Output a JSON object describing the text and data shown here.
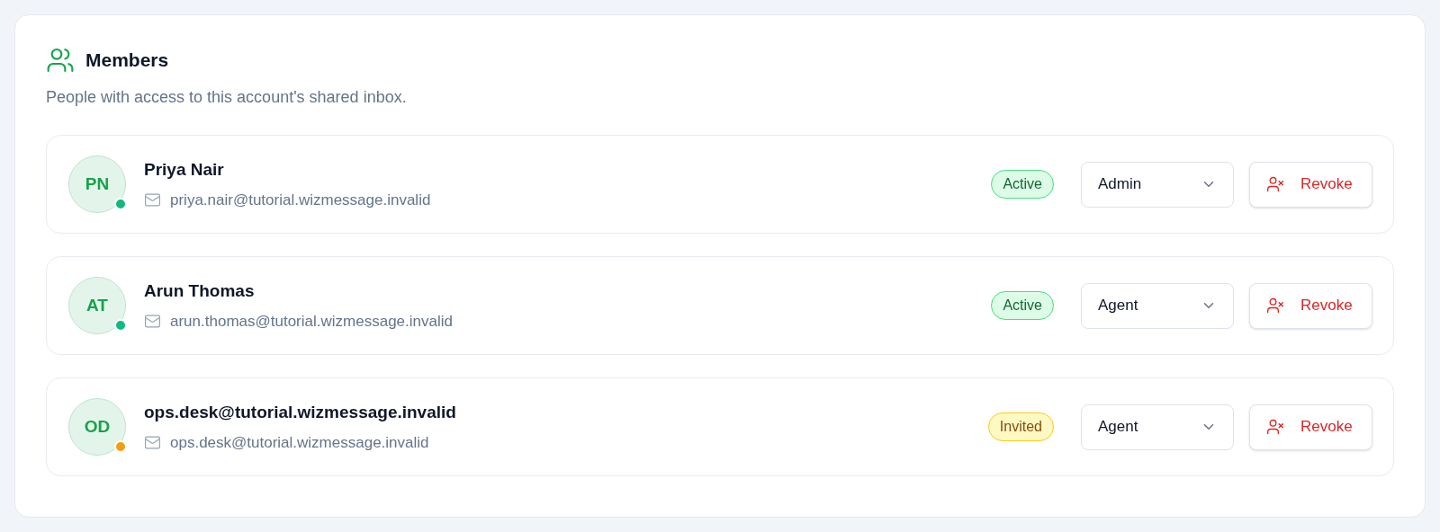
{
  "header": {
    "title": "Members",
    "subtitle": "People with access to this account's shared inbox."
  },
  "members": [
    {
      "initials": "PN",
      "name": "Priya Nair",
      "email": "priya.nair@tutorial.wizmessage.invalid",
      "color": "#10b981",
      "status": {
        "kind": "active",
        "label": "Active"
      },
      "role": "Admin",
      "action": "Revoke"
    },
    {
      "initials": "AT",
      "name": "Arun Thomas",
      "email": "arun.thomas@tutorial.wizmessage.invalid",
      "color": "#10b981",
      "status": {
        "kind": "active",
        "label": "Active"
      },
      "role": "Agent",
      "action": "Revoke"
    },
    {
      "initials": "OD",
      "name": "ops.desk@tutorial.wizmessage.invalid",
      "email": "ops.desk@tutorial.wizmessage.invalid",
      "color": "#f59e0b",
      "status": {
        "kind": "invited",
        "label": "Invited"
      },
      "role": "Agent",
      "action": "Revoke"
    }
  ]
}
